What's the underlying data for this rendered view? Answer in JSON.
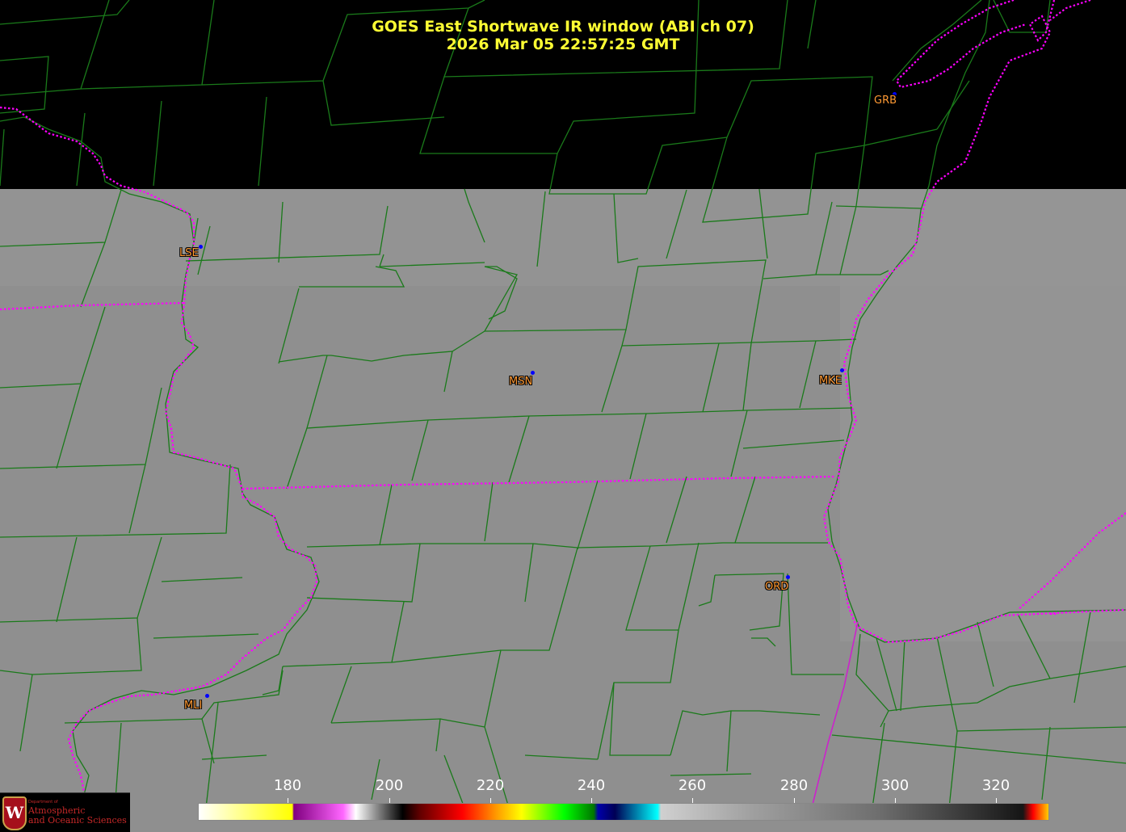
{
  "title": {
    "line1": "GOES East Shortwave IR window (ABI ch 07)",
    "line2": "2026 Mar 05  22:57:25 GMT"
  },
  "colors": {
    "title_text": "#ffff33",
    "city_label": "#ff9933",
    "city_dot": "#0000ff",
    "state_border": "#ff00ff",
    "county_border": "#1a7a1a",
    "cloud_gray": "#8f8f8f",
    "no_data": "#000000"
  },
  "cities": [
    {
      "code": "GRB"
    },
    {
      "code": "LSE"
    },
    {
      "code": "MSN"
    },
    {
      "code": "MKE"
    },
    {
      "code": "ORD"
    },
    {
      "code": "MLI"
    }
  ],
  "colorbar": {
    "ticks": [
      "180",
      "200",
      "220",
      "240",
      "260",
      "280",
      "300",
      "320"
    ]
  },
  "logo": {
    "crest_letter": "W",
    "small_text": "Department of",
    "line1": "Atmospheric",
    "line2": "and Oceanic Sciences"
  }
}
